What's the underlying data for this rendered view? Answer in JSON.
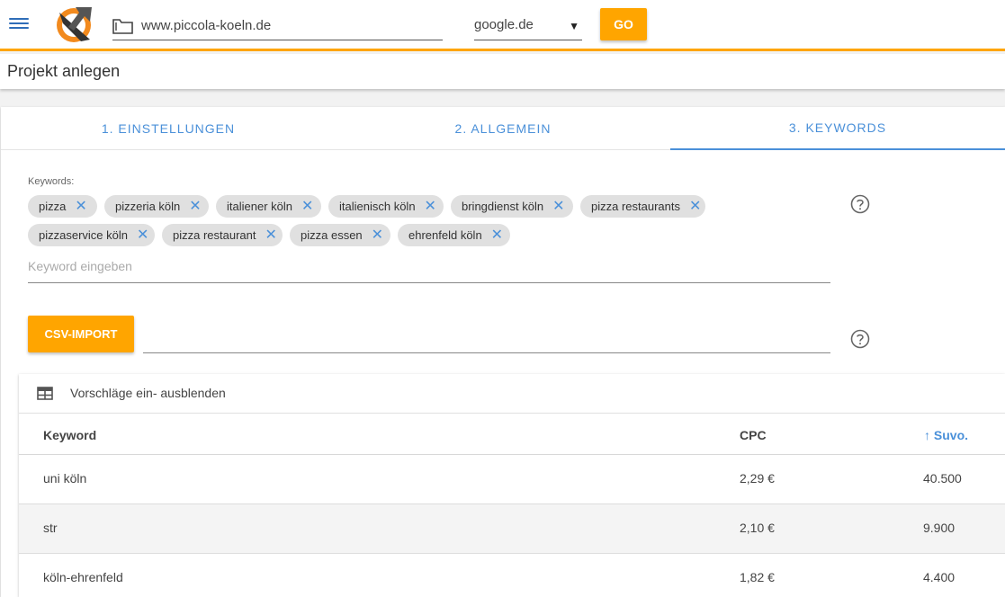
{
  "header": {
    "url_value": "www.piccola-koeln.de",
    "engine_value": "google.de",
    "go_label": "GO"
  },
  "page": {
    "title": "Projekt anlegen"
  },
  "tabs": [
    {
      "label": "1. EINSTELLUNGEN",
      "active": false
    },
    {
      "label": "2. ALLGEMEIN",
      "active": false
    },
    {
      "label": "3. KEYWORDS",
      "active": true
    }
  ],
  "keywords": {
    "label": "Keywords:",
    "chips": [
      "pizza",
      "pizzeria köln",
      "italiener köln",
      "italienisch köln",
      "bringdienst köln",
      "pizza restaurants",
      "pizzaservice köln",
      "pizza restaurant",
      "pizza essen",
      "ehrenfeld köln"
    ],
    "remove_glyph": "✕",
    "input_placeholder": "Keyword eingeben"
  },
  "csv": {
    "button_label": "CSV-IMPORT"
  },
  "suggestions": {
    "toggle_label": "Vorschläge ein- ausblenden",
    "columns": {
      "keyword": "Keyword",
      "cpc": "CPC",
      "volume": "Suvo."
    },
    "sort_arrow": "↑",
    "rows": [
      {
        "keyword": "uni köln",
        "cpc": "2,29 €",
        "volume": "40.500"
      },
      {
        "keyword": "str",
        "cpc": "2,10 €",
        "volume": "9.900"
      },
      {
        "keyword": "köln-ehrenfeld",
        "cpc": "1,82 €",
        "volume": "4.400"
      }
    ]
  },
  "colors": {
    "accent": "#ffa500",
    "link": "#4a90d9"
  },
  "icons": [
    "menu-icon",
    "logo",
    "folder-icon",
    "dropdown-caret-icon",
    "help-icon",
    "table-icon",
    "close-icon",
    "arrow-up-icon"
  ]
}
